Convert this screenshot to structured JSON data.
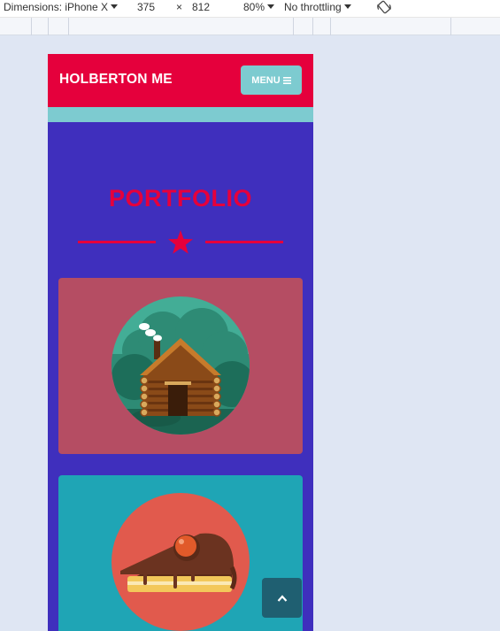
{
  "devtools": {
    "dimensions_label": "Dimensions: iPhone X",
    "width": "375",
    "times": "×",
    "height": "812",
    "zoom": "80%",
    "throttling": "No throttling"
  },
  "site": {
    "brand": "HOLBERTON ME",
    "menu_label": "MENU",
    "menu_icon": "hamburger-icon",
    "section_title": "PORTFOLIO",
    "divider_icon": "star-icon",
    "portfolio": [
      {
        "image": "cabin-icon",
        "bg": "#b54d63"
      },
      {
        "image": "cake-icon",
        "bg": "#1fa5b5"
      }
    ],
    "scroll_top_icon": "chevron-up-icon"
  },
  "colors": {
    "header": "#e5003c",
    "accent": "#7dcbd0",
    "page": "#3f2fbd",
    "title": "#e5003c"
  }
}
